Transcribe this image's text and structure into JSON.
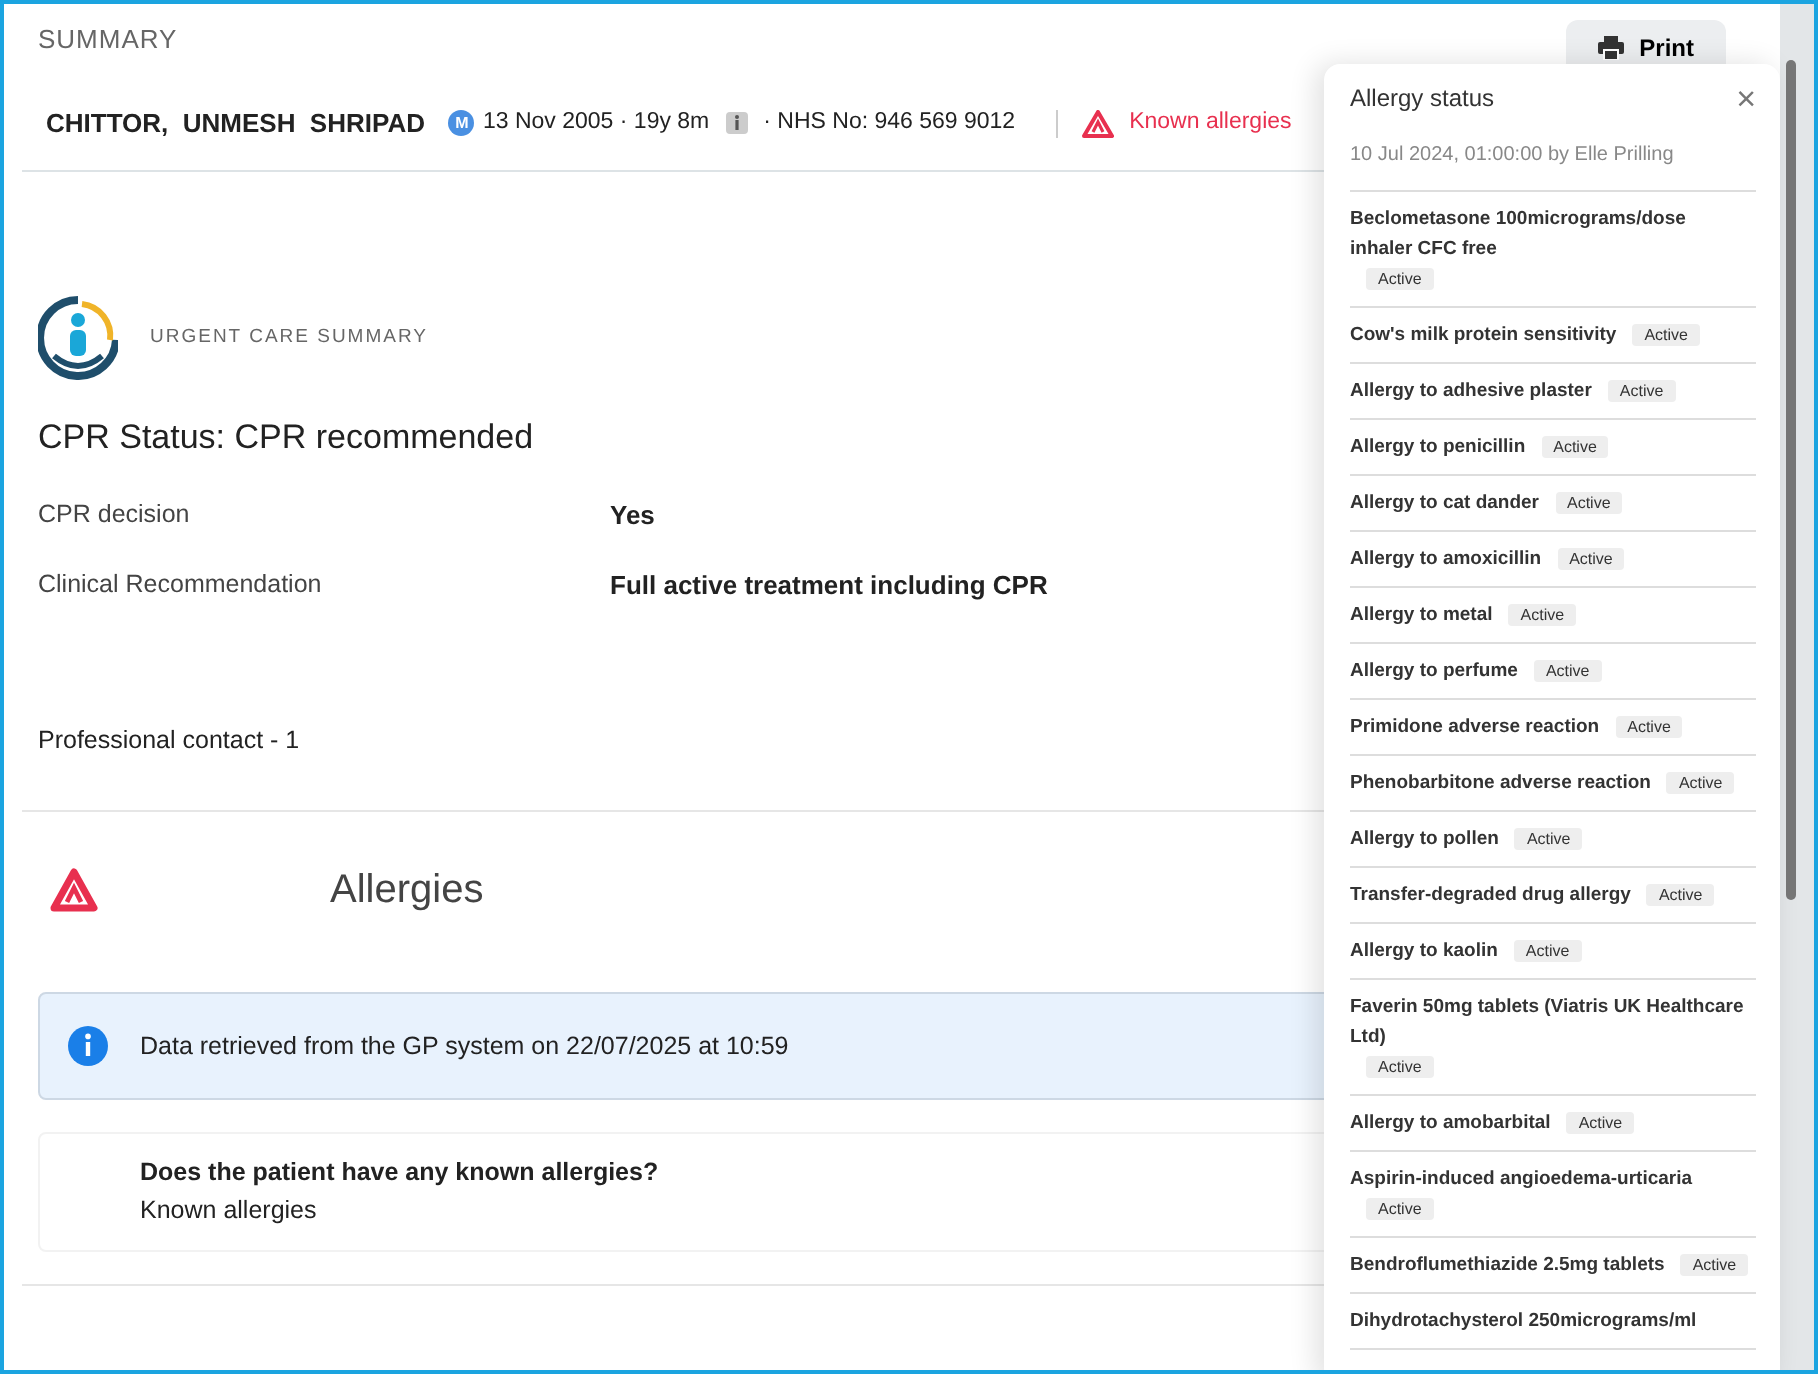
{
  "header": {
    "title": "SUMMARY",
    "print_button": "Print"
  },
  "patient": {
    "name": "CHITTOR,  UNMESH  SHRIPAD",
    "gender_badge": "M",
    "dob": "13 Nov 2005 · 19y 8m",
    "nhs": "· NHS No: 946 569 9012",
    "alert": "Known allergies"
  },
  "care_summary": {
    "label": "URGENT CARE SUMMARY",
    "cpr_status": "CPR Status: CPR recommended",
    "fields": [
      {
        "label": "CPR decision",
        "value": "Yes"
      },
      {
        "label": "Clinical Recommendation",
        "value": "Full active treatment including CPR"
      }
    ],
    "contact": "Professional contact - 1"
  },
  "allergies": {
    "title": "Allergies",
    "info": "Data retrieved from the GP system on 22/07/2025 at 10:59",
    "question": "Does the patient have any known allergies?",
    "answer": "Known allergies"
  },
  "popover": {
    "title": "Allergy status",
    "close": "×",
    "recorded": "10 Jul 2024, 01:00:00 by Elle Prilling",
    "items": [
      {
        "name": "Beclometasone 100micrograms/dose inhaler CFC free",
        "status": "Active"
      },
      {
        "name": "Cow's milk protein sensitivity",
        "status": "Active"
      },
      {
        "name": "Allergy to adhesive plaster",
        "status": "Active"
      },
      {
        "name": "Allergy to penicillin",
        "status": "Active"
      },
      {
        "name": "Allergy to cat dander",
        "status": "Active"
      },
      {
        "name": "Allergy to amoxicillin",
        "status": "Active"
      },
      {
        "name": "Allergy to metal",
        "status": "Active"
      },
      {
        "name": "Allergy to perfume",
        "status": "Active"
      },
      {
        "name": "Primidone adverse reaction",
        "status": "Active"
      },
      {
        "name": "Phenobarbitone adverse reaction",
        "status": "Active"
      },
      {
        "name": "Allergy to pollen",
        "status": "Active"
      },
      {
        "name": "Transfer-degraded drug allergy",
        "status": "Active"
      },
      {
        "name": "Allergy to kaolin",
        "status": "Active"
      },
      {
        "name": "Faverin 50mg tablets (Viatris UK Healthcare Ltd)",
        "status": "Active"
      },
      {
        "name": "Allergy to amobarbital",
        "status": "Active"
      },
      {
        "name": "Aspirin-induced angioedema-urticaria",
        "status": "Active"
      },
      {
        "name": "Bendroflumethiazide 2.5mg tablets",
        "status": "Active"
      },
      {
        "name": "Dihydrotachysterol 250micrograms/ml"
      }
    ]
  }
}
